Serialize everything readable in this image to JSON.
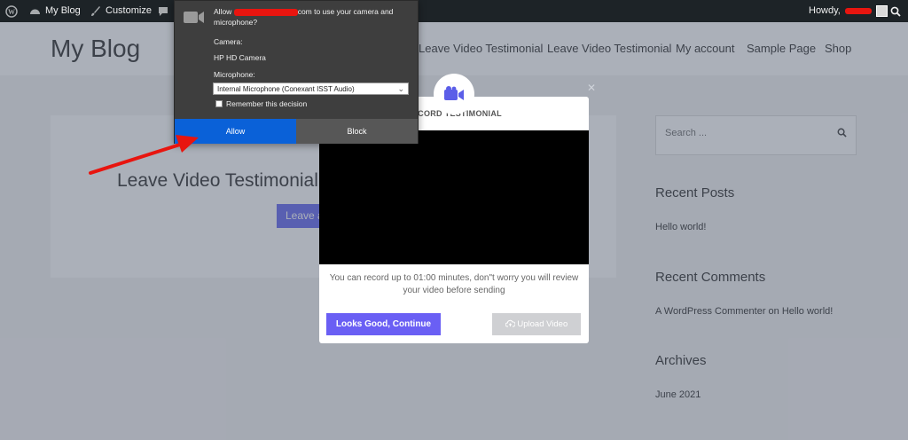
{
  "admin_bar": {
    "site_name": "My Blog",
    "customize_label": "Customize",
    "greeting": "Howdy,"
  },
  "header": {
    "site_title": "My Blog",
    "nav": [
      "Leave Video Testimonial",
      "Leave Video Testimonial",
      "My account",
      "Sample Page",
      "Shop"
    ]
  },
  "article": {
    "title": "Leave Video Testimonial",
    "button_label": "Leave a"
  },
  "sidebar": {
    "search_placeholder": "Search ...",
    "recent_posts_title": "Recent Posts",
    "recent_post": "Hello world!",
    "recent_comments_title": "Recent Comments",
    "recent_comment": "A WordPress Commenter on Hello world!",
    "archives_title": "Archives",
    "archive_item": "June 2021"
  },
  "modal": {
    "heading": "RECORD TESTIMONIAL",
    "note": "You can record up to 01:00 minutes, don\"t worry you will review your video before sending",
    "continue_label": "Looks Good, Continue",
    "upload_label": "Upload Video",
    "accent": "#6a5ff4"
  },
  "permission": {
    "allow_prefix": "Allow",
    "allow_domain_suffix": "com to use your camera and microphone?",
    "camera_label": "Camera:",
    "camera_value": "HP HD Camera",
    "microphone_label": "Microphone:",
    "microphone_value": "Internal Microphone (Conexant ISST Audio)",
    "remember_label": "Remember this decision",
    "allow_button": "Allow",
    "block_button": "Block",
    "allow_color": "#0a61d8"
  },
  "annotation": {
    "arrow_color": "#e8150f"
  }
}
